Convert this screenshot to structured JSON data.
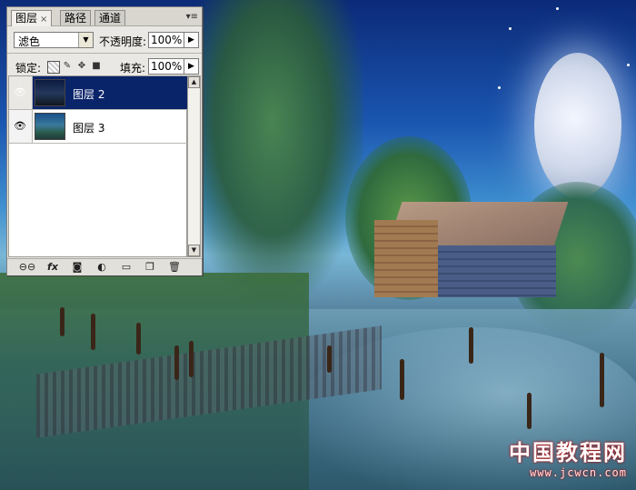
{
  "panel": {
    "tabs": [
      {
        "label": "图层",
        "active": true,
        "close": "×"
      },
      {
        "label": "路径",
        "active": false
      },
      {
        "label": "通道",
        "active": false
      }
    ],
    "menu_icon": "▾≡",
    "blend_mode": "滤色",
    "opacity_label": "不透明度:",
    "opacity_value": "100%",
    "lock_label": "锁定:",
    "lock_icons": [
      "lock-transparent-icon",
      "lock-image-icon",
      "lock-position-icon",
      "lock-all-icon"
    ],
    "fill_label": "填充:",
    "fill_value": "100%",
    "layers": [
      {
        "name": "图层 2",
        "selected": true,
        "visible": true
      },
      {
        "name": "图层 3",
        "selected": false,
        "visible": true
      }
    ],
    "bottom_icons": [
      "link-layers-icon",
      "layer-style-icon",
      "layer-mask-icon",
      "adjustment-layer-icon",
      "new-group-icon",
      "new-layer-icon",
      "delete-layer-icon"
    ]
  },
  "watermark": {
    "title": "中国教程网",
    "url": "www.jcwcn.com"
  },
  "colors": {
    "selection": "#0a246a",
    "panel_bg": "#e9e8e4"
  }
}
